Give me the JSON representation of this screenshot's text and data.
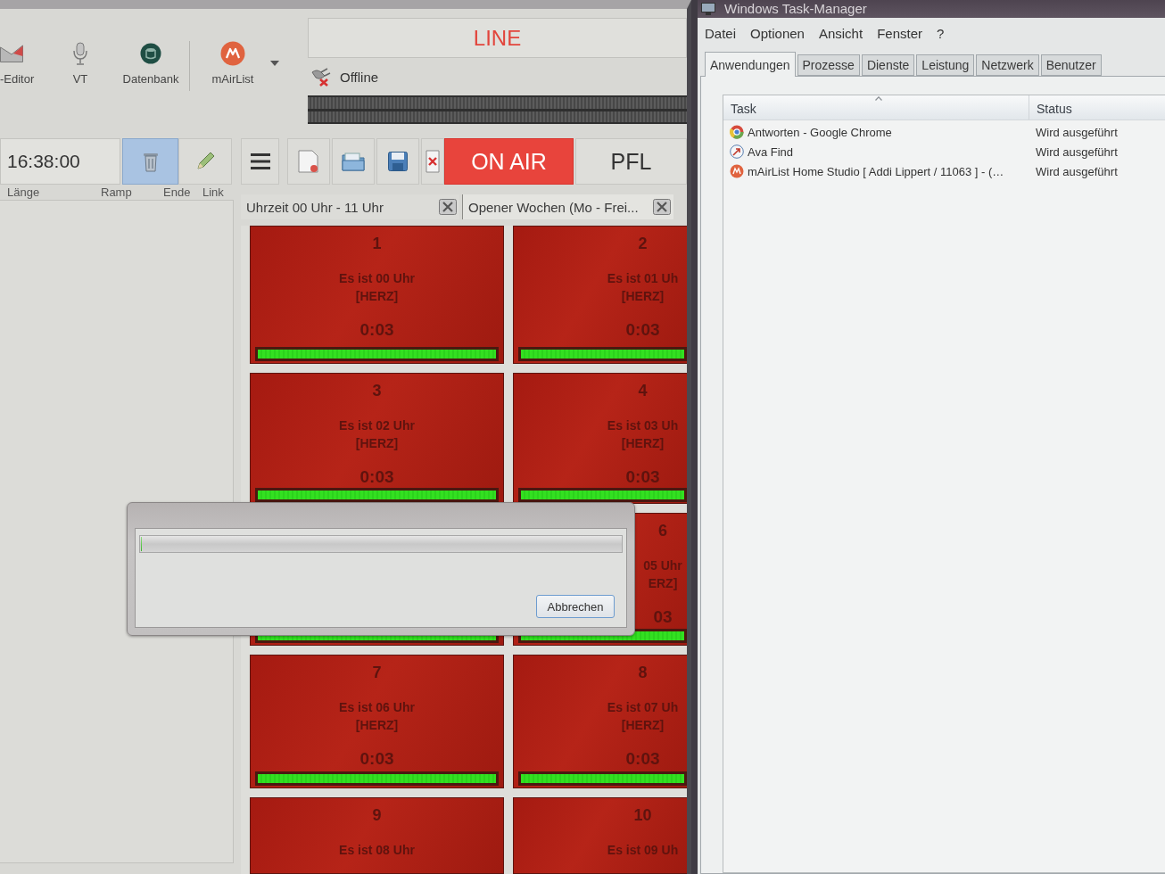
{
  "ribbon": {
    "tools": [
      {
        "label": "-Editor",
        "dropdown": false
      },
      {
        "label": "VT",
        "dropdown": false
      },
      {
        "label": "Datenbank",
        "dropdown": false
      },
      {
        "label": "mAirList",
        "dropdown": true
      }
    ],
    "line_panel": {
      "label": "LINE"
    },
    "connection": {
      "status": "Offline"
    }
  },
  "toolbar": {
    "clock": "16:38:00",
    "view_buttons": [
      {
        "selected": true
      },
      {
        "selected": false
      }
    ],
    "on_air": {
      "label": "ON AIR",
      "on": true
    },
    "pfl": {
      "label": "PFL",
      "on": false
    }
  },
  "playlist": {
    "columns": [
      "Länge",
      "Ramp",
      "Ende",
      "Link"
    ]
  },
  "cart_tabs": [
    {
      "label": "Uhrzeit 00 Uhr - 11 Uhr",
      "selected": true
    },
    {
      "label": "Opener Wochen (Mo - Frei...",
      "selected": false
    }
  ],
  "carts": [
    {
      "kind": "full",
      "number": "1",
      "title": "Es ist 00 Uhr",
      "tag": "[HERZ]",
      "duration": "0:03",
      "level": 1
    },
    {
      "kind": "cut",
      "number": "2",
      "title": "Es ist 01 Uh",
      "tag": "[HERZ]",
      "duration": "0:03",
      "level": 1
    },
    {
      "kind": "full",
      "number": "3",
      "title": "Es ist 02 Uhr",
      "tag": "[HERZ]",
      "duration": "0:03",
      "level": 1
    },
    {
      "kind": "cut",
      "number": "4",
      "title": "Es ist 03 Uh",
      "tag": "[HERZ]",
      "duration": "0:03",
      "level": 1
    },
    {
      "kind": "full",
      "level": 1
    },
    {
      "kind": "covered",
      "number": "6",
      "title": "05 Uhr",
      "tag": "ERZ]",
      "duration": "03",
      "level": 1
    },
    {
      "kind": "full",
      "number": "7",
      "title": "Es ist 06 Uhr",
      "tag": "[HERZ]",
      "duration": "0:03",
      "level": 1
    },
    {
      "kind": "cut",
      "number": "8",
      "title": "Es ist 07 Uh",
      "tag": "[HERZ]",
      "duration": "0:03",
      "level": 1
    },
    {
      "kind": "full",
      "number": "9",
      "title": "Es ist 08 Uhr"
    },
    {
      "kind": "cut",
      "number": "10",
      "title": "Es ist 09 Uh"
    }
  ],
  "dialog": {
    "progress": {
      "level": 0
    },
    "cancel_button": "Abbrechen"
  },
  "task_manager": {
    "title": "Windows Task-Manager",
    "menu": [
      "Datei",
      "Optionen",
      "Ansicht",
      "Fenster",
      "?"
    ],
    "tabs": [
      {
        "label": "Anwendungen",
        "selected": true
      },
      {
        "label": "Prozesse",
        "selected": false
      },
      {
        "label": "Dienste",
        "selected": false
      },
      {
        "label": "Leistung",
        "selected": false
      },
      {
        "label": "Netzwerk",
        "selected": false
      },
      {
        "label": "Benutzer",
        "selected": false
      }
    ],
    "columns": [
      "Task",
      "Status"
    ],
    "rows": [
      {
        "task": "Antworten - Google Chrome",
        "status": "Wird ausgeführt"
      },
      {
        "task": "Ava Find",
        "status": "Wird ausgeführt"
      },
      {
        "task": "mAirList Home Studio [ Addi Lippert / 11063 ] - (…",
        "status": "Wird ausgeführt"
      }
    ]
  }
}
